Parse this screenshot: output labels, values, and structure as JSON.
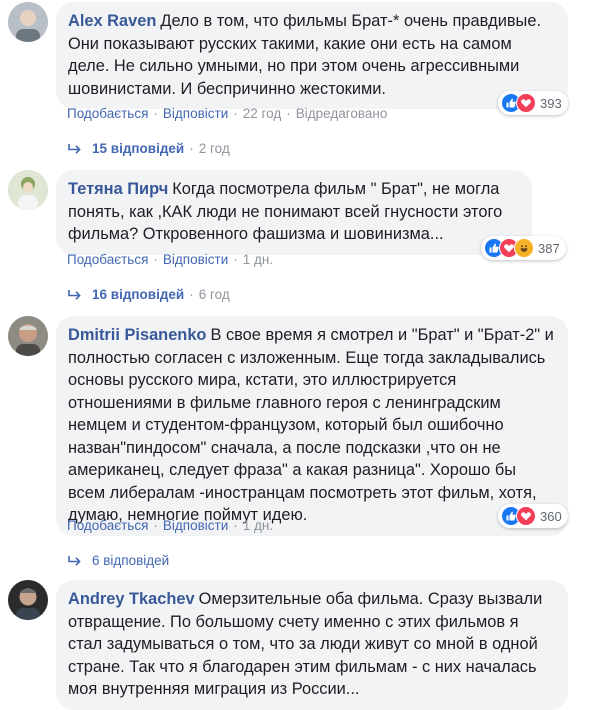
{
  "colors": {
    "link": "#4267b2",
    "author": "#385898",
    "bubble": "#f2f3f5",
    "muted": "#90949c"
  },
  "comments": [
    {
      "author": "Alex Raven",
      "text": "Дело в том, что фильмы Брат-* очень правдивые. Они показывают русских такими, какие они есть на самом деле. Не сильно умными, но при этом очень агрессивными шовинистами. И беспричинно жестокими.",
      "reaction_icons": [
        "like-icon",
        "love-icon"
      ],
      "reaction_count": "393",
      "like_label": "Подобається",
      "reply_label": "Відповісти",
      "time": "22 год",
      "edited": "Відредаговано",
      "replies_label": "15 відповідей",
      "replies_time": "2 год"
    },
    {
      "author": "Тетяна Пирч",
      "text": "Когда посмотрела фильм \" Брат\", не могла понять, как ,КАК люди не понимают всей гнусности этого фильма? Откровенного фашизма и шовинизма...",
      "reaction_icons": [
        "like-icon",
        "love-icon",
        "haha-icon"
      ],
      "reaction_count": "387",
      "like_label": "Подобається",
      "reply_label": "Відповісти",
      "time": "1 дн.",
      "replies_label": "16 відповідей",
      "replies_time": "6 год"
    },
    {
      "author": "Dmitrii Pisanenko",
      "text": "В свое время я смотрел и \"Брат\" и \"Брат-2\" и полностью согласен с изложенным. Еще тогда закладывались основы русского мира, кстати, это иллюстрируется отношениями в фильме главного героя с ленинградским немцем и студентом-французом, который был ошибочно назван\"пиндосом\" сначала, а после подсказки ,что он не американец, следует фраза\" а какая разница\". Хорошо бы всем либералам -иностранцам посмотреть этот фильм, хотя, думаю, немногие поймут идею.",
      "reaction_icons": [
        "like-icon",
        "love-icon"
      ],
      "reaction_count": "360",
      "like_label": "Подобається",
      "reply_label": "Відповісти",
      "time": "1 дн.",
      "replies_label": "6 відповідей"
    },
    {
      "author": "Andrey Tkachev",
      "text": "Омерзительные оба фильма. Сразу вызвали отвращение. По большому счету именно с этих фильмов я стал задумываться о том, что за люди живут со мной в одной стране. Так что я благодарен этим фильмам - с них началась моя внутренняя миграция из России..."
    }
  ]
}
